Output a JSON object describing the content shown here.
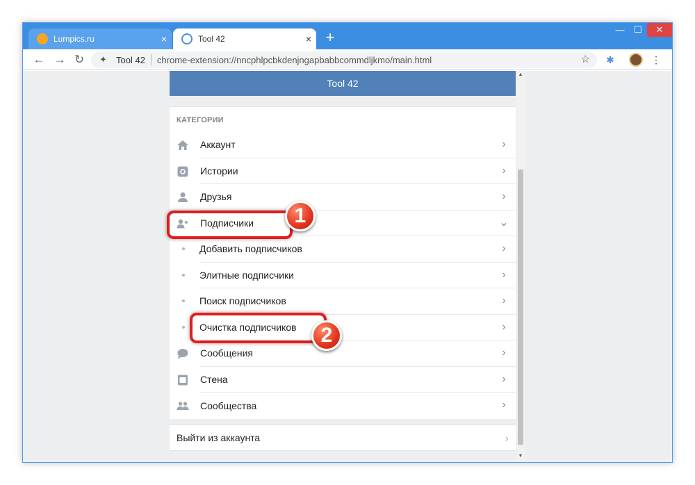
{
  "browser": {
    "tabs": [
      {
        "title": "Lumpics.ru",
        "favicon_color": "#f5a623",
        "active": false
      },
      {
        "title": "Tool 42",
        "favicon_color": "#4a90e2",
        "active": true
      }
    ],
    "address": {
      "site": "Tool 42",
      "url": "chrome-extension://nncphlpcbkdenjngapbabbcommdljkmo/main.html"
    },
    "icons": {
      "close_tab": "×",
      "new_tab": "+",
      "minimize": "—",
      "maximize": "☐",
      "close": "✕",
      "back": "←",
      "forward": "→",
      "reload": "↻",
      "star": "☆",
      "menu": "⋮",
      "extension": "✱",
      "puzzle": "✦"
    }
  },
  "app": {
    "header_title": "Tool 42",
    "category_title": "КАТЕГОРИИ",
    "items": [
      {
        "label": "Аккаунт",
        "icon": "home-icon",
        "chevron": "›"
      },
      {
        "label": "Истории",
        "icon": "stories-icon",
        "chevron": "›"
      },
      {
        "label": "Друзья",
        "icon": "user-icon",
        "chevron": "›"
      },
      {
        "label": "Подписчики",
        "icon": "followers-icon",
        "chevron": "⌄",
        "expanded": true
      },
      {
        "label": "Добавить подписчиков",
        "sub": true,
        "chevron": "›"
      },
      {
        "label": "Элитные подписчики",
        "sub": true,
        "chevron": "›"
      },
      {
        "label": "Поиск подписчиков",
        "sub": true,
        "chevron": "›"
      },
      {
        "label": "Очистка подписчиков",
        "sub": true,
        "chevron": "›"
      },
      {
        "label": "Сообщения",
        "icon": "message-icon",
        "chevron": "›"
      },
      {
        "label": "Стена",
        "icon": "wall-icon",
        "chevron": "›"
      },
      {
        "label": "Сообщества",
        "icon": "groups-icon",
        "chevron": "›"
      }
    ],
    "logout_label": "Выйти из аккаунта",
    "logout_chevron": "›"
  },
  "annotations": [
    {
      "number": "1",
      "color": "#e11d1d"
    },
    {
      "number": "2",
      "color": "#e11d1d"
    }
  ]
}
